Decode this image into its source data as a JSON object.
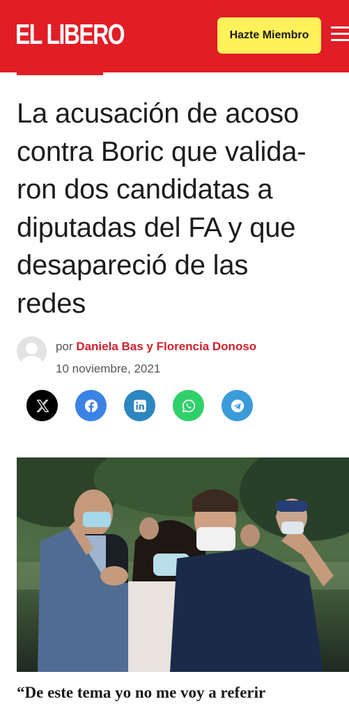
{
  "header": {
    "logo_text": "EL LIBERO",
    "cta_label": "Hazte Miembro",
    "menu_icon": "hamburger-menu-icon",
    "brand_color": "#e11d26",
    "cta_color": "#fff15a"
  },
  "article": {
    "title_lines": [
      "La acusación de acoso",
      "contra Boric que valida-",
      "ron dos candidatas a",
      "diputadas del FA y que",
      "desapareció de las",
      "redes"
    ],
    "by_prefix": "por",
    "authors": "Daniela Bas y Florencia Donoso",
    "date": "10 noviembre, 2021",
    "avatar_icon": "user-avatar-placeholder-icon",
    "photo_icon": "article-photo",
    "quote_start": "“De este tema yo no me voy a referir"
  },
  "share": [
    {
      "name": "X",
      "icon": "x-logo-icon",
      "color": "#000000"
    },
    {
      "name": "Facebook",
      "icon": "facebook-icon",
      "color": "#3b82e6"
    },
    {
      "name": "LinkedIn",
      "icon": "linkedin-icon",
      "color": "#2e86c1"
    },
    {
      "name": "WhatsApp",
      "icon": "whatsapp-icon",
      "color": "#2fd06a"
    },
    {
      "name": "Telegram",
      "icon": "telegram-icon",
      "color": "#3a9bd9"
    }
  ]
}
